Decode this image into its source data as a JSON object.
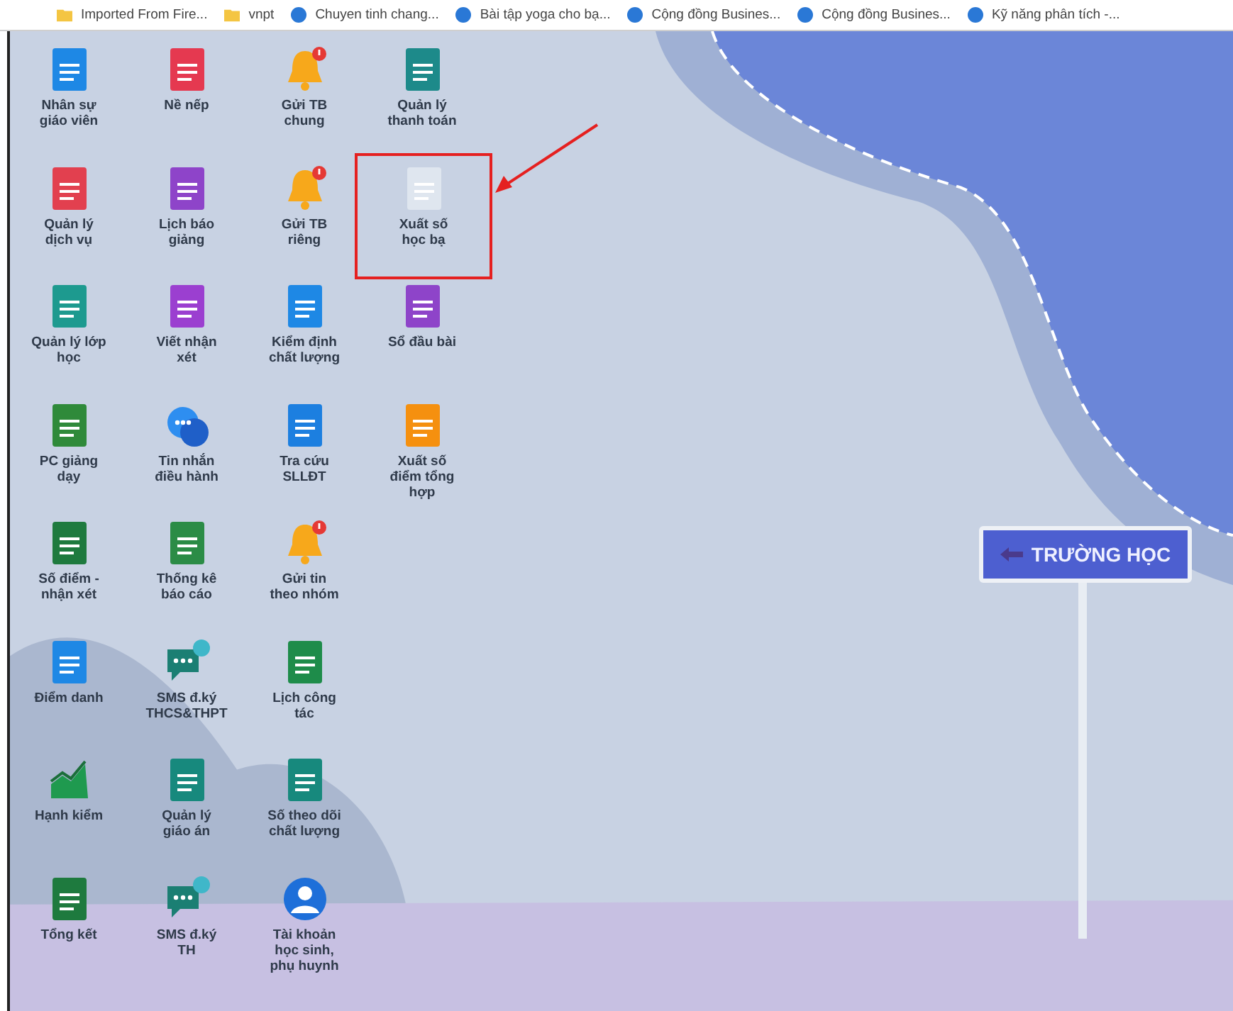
{
  "bookmarks": [
    {
      "label": "Imported From Fire...",
      "kind": "folder"
    },
    {
      "label": "vnpt",
      "kind": "folder"
    },
    {
      "label": "Chuyen tinh chang...",
      "kind": "site"
    },
    {
      "label": "Bài tập yoga cho bạ...",
      "kind": "site"
    },
    {
      "label": "Cộng đồng Busines...",
      "kind": "site"
    },
    {
      "label": "Cộng đồng Busines...",
      "kind": "site"
    },
    {
      "label": "Kỹ năng phân tích -...",
      "kind": "site"
    }
  ],
  "apps": [
    [
      {
        "label": "Nhân sự\ngiáo viên",
        "highlighted": false
      },
      {
        "label": "Nề nếp",
        "highlighted": false
      },
      {
        "label": "Gửi TB\nchung",
        "highlighted": false
      },
      {
        "label": "Quản lý\nthanh toán",
        "highlighted": false
      }
    ],
    [
      {
        "label": "Quản lý\ndịch vụ",
        "highlighted": false
      },
      {
        "label": "Lịch báo\ngiảng",
        "highlighted": false
      },
      {
        "label": "Gửi TB\nriêng",
        "highlighted": false
      },
      {
        "label": "Xuất số\nhọc bạ",
        "highlighted": true
      }
    ],
    [
      {
        "label": "Quản lý lớp\nhọc",
        "highlighted": false
      },
      {
        "label": "Viết nhận\nxét",
        "highlighted": false
      },
      {
        "label": "Kiểm định\nchất lượng",
        "highlighted": false
      },
      {
        "label": "Sổ đầu bài",
        "highlighted": false
      }
    ],
    [
      {
        "label": "PC giảng\ndạy",
        "highlighted": false
      },
      {
        "label": "Tin nhắn\nđiều hành",
        "highlighted": false
      },
      {
        "label": "Tra cứu\nSLLĐT",
        "highlighted": false
      },
      {
        "label": "Xuất số\nđiểm tổng\nhợp",
        "highlighted": false
      }
    ],
    [
      {
        "label": "Số điểm -\nnhận xét",
        "highlighted": false
      },
      {
        "label": "Thống kê\nbáo cáo",
        "highlighted": false
      },
      {
        "label": "Gửi tin\ntheo nhóm",
        "highlighted": false
      }
    ],
    [
      {
        "label": "Điểm danh",
        "highlighted": false
      },
      {
        "label": "SMS đ.ký\nTHCS&THPT",
        "highlighted": false
      },
      {
        "label": "Lịch công\ntác",
        "highlighted": false
      }
    ],
    [
      {
        "label": "Hạnh kiểm",
        "highlighted": false
      },
      {
        "label": "Quản lý\ngiáo án",
        "highlighted": false
      },
      {
        "label": "Số theo dõi\nchất lượng",
        "highlighted": false
      }
    ],
    [
      {
        "label": "Tổng kết",
        "highlighted": false
      },
      {
        "label": "SMS đ.ký\nTH",
        "highlighted": false
      },
      {
        "label": "Tài khoản\nhọc sinh,\nphụ huynh",
        "highlighted": false
      }
    ]
  ],
  "signpost": {
    "label": "TRƯỜNG HỌC"
  }
}
